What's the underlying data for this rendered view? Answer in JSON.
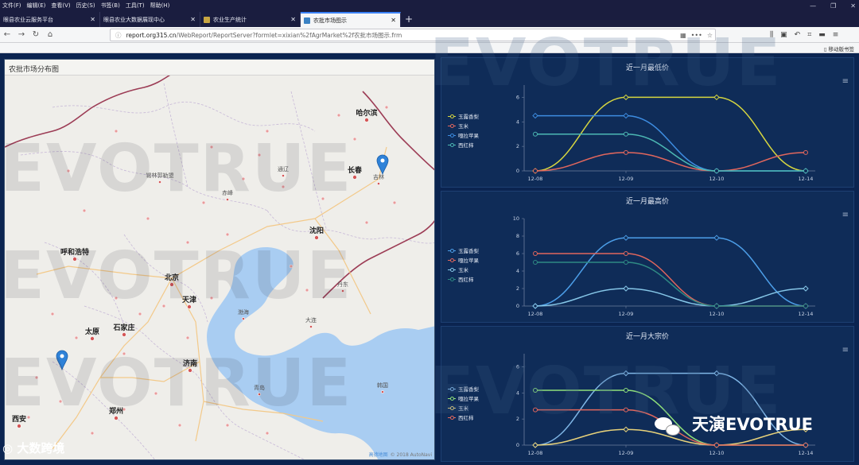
{
  "menubar": {
    "items": [
      "文件(F)",
      "编辑(E)",
      "查看(V)",
      "历史(S)",
      "书签(B)",
      "工具(T)",
      "帮助(H)"
    ]
  },
  "tabs": [
    {
      "label": "眼县农业云服务平台",
      "active": false
    },
    {
      "label": "眼县农业大数据展现中心",
      "active": false
    },
    {
      "label": "农业生产统计",
      "active": false
    },
    {
      "label": "农批市场图示",
      "active": true
    }
  ],
  "address": {
    "host": "report.org315.cn",
    "path": "/WebReport/ReportServer?formlet=xixian%2fAgrMarket%2f农批市场图示.frm"
  },
  "bookmarks": {
    "mobile": "移动版书签"
  },
  "map": {
    "title": "农批市场分布图",
    "copyright_service": "高德地图",
    "copyright": "© 2018 AutoNavi",
    "cities": [
      {
        "name": "哈尔滨",
        "major": true
      },
      {
        "name": "长春",
        "major": true
      },
      {
        "name": "沈阳",
        "major": true
      },
      {
        "name": "北京",
        "major": true
      },
      {
        "name": "天津",
        "major": true
      },
      {
        "name": "石家庄",
        "major": true
      },
      {
        "name": "太原",
        "major": true
      },
      {
        "name": "济南",
        "major": true
      },
      {
        "name": "郑州",
        "major": true
      },
      {
        "name": "西安",
        "major": true
      },
      {
        "name": "呼和浩特",
        "major": true
      },
      {
        "name": "吉林",
        "major": false
      },
      {
        "name": "锡林郭勒盟",
        "major": false
      },
      {
        "name": "大连",
        "major": false
      },
      {
        "name": "青岛",
        "major": false
      },
      {
        "name": "韩国",
        "major": false
      },
      {
        "name": "丹东",
        "major": false
      },
      {
        "name": "通辽",
        "major": false
      },
      {
        "name": "赤峰",
        "major": false
      },
      {
        "name": "渤海",
        "major": false
      }
    ]
  },
  "watermark": {
    "text": "EVOTRUE",
    "bottom_logo": "大数跨境",
    "wechat_text": "天演EVOTRUE"
  },
  "charts": [
    {
      "title": "近一月最低价",
      "categories": [
        "12-08",
        "12-09",
        "12-10",
        "12-14"
      ],
      "ylim": [
        0,
        7
      ],
      "yticks": [
        0,
        2,
        4,
        6
      ],
      "series": [
        {
          "name": "玉露香梨",
          "color": "#d6d640",
          "values": [
            0,
            6,
            6,
            0
          ]
        },
        {
          "name": "玉米",
          "color": "#e2675d",
          "values": [
            0,
            1.5,
            0,
            1.5
          ]
        },
        {
          "name": "嘎拉苹果",
          "color": "#3d8ce0",
          "values": [
            4.5,
            4.5,
            0,
            0
          ]
        },
        {
          "name": "西红柿",
          "color": "#4cb8b3",
          "values": [
            3,
            3,
            0,
            0
          ]
        }
      ]
    },
    {
      "title": "近一月最高价",
      "categories": [
        "12-08",
        "12-09",
        "12-10",
        "12-14"
      ],
      "ylim": [
        0,
        10
      ],
      "yticks": [
        0,
        2,
        4,
        6,
        8,
        10
      ],
      "series": [
        {
          "name": "玉露香梨",
          "color": "#4c9ee8",
          "values": [
            0,
            7.8,
            7.8,
            0
          ]
        },
        {
          "name": "嘎拉苹果",
          "color": "#e2675d",
          "values": [
            6,
            6,
            0,
            0
          ]
        },
        {
          "name": "玉米",
          "color": "#86c7e8",
          "values": [
            0,
            2,
            0,
            2
          ]
        },
        {
          "name": "西红柿",
          "color": "#2f8a84",
          "values": [
            5,
            5,
            0,
            0
          ]
        }
      ]
    },
    {
      "title": "近一月大宗价",
      "categories": [
        "12-08",
        "12-09",
        "12-10",
        "12-14"
      ],
      "ylim": [
        0,
        7
      ],
      "yticks": [
        0,
        2,
        4,
        6
      ],
      "series": [
        {
          "name": "玉露香梨",
          "color": "#7fb6e6",
          "values": [
            0,
            5.5,
            5.5,
            0
          ]
        },
        {
          "name": "嘎拉苹果",
          "color": "#8fe07a",
          "values": [
            4.2,
            4.2,
            0,
            0
          ]
        },
        {
          "name": "玉米",
          "color": "#e8d27a",
          "values": [
            0,
            1.2,
            0,
            1.2
          ]
        },
        {
          "name": "西红柿",
          "color": "#e2675d",
          "values": [
            2.7,
            2.7,
            0,
            0
          ]
        }
      ]
    }
  ]
}
